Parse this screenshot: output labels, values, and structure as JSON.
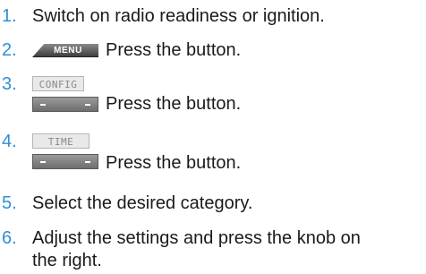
{
  "steps": [
    {
      "num": "1.",
      "text": "Switch on radio readiness or ignition."
    },
    {
      "num": "2.",
      "button": "MENU",
      "text": "Press the button."
    },
    {
      "num": "3.",
      "display": "CONFIG",
      "text": "Press the button."
    },
    {
      "num": "4.",
      "display": "TIME",
      "text": "Press the button."
    },
    {
      "num": "5.",
      "text": "Select the desired category."
    },
    {
      "num": "6.",
      "text_line1": "Adjust the settings and press the knob on",
      "text_line2": "the right."
    }
  ],
  "colors": {
    "step_number": "#2f8fd8",
    "text": "#1a1a1a",
    "menu_button": "#3f3f3f",
    "softkey": "#8a8a8a",
    "lcd_bg": "#e9e9e9"
  },
  "icons": {
    "menu_button": "menu-button",
    "softkey": "softkey-button",
    "lcd_display": "lcd-display"
  }
}
